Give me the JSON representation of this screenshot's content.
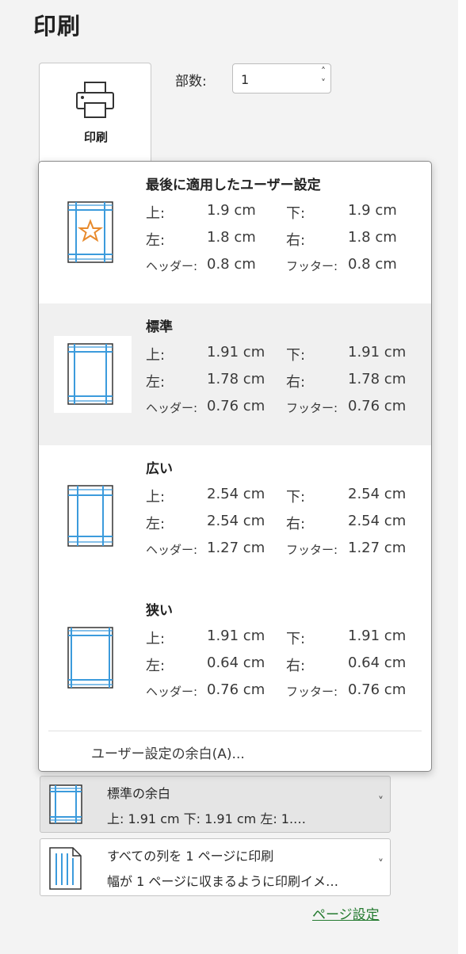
{
  "title": "印刷",
  "print_button": {
    "label": "印刷"
  },
  "copies": {
    "label": "部数:",
    "value": "1"
  },
  "margin_options": [
    {
      "name": "最後に適用したユーザー設定",
      "top_label": "上:",
      "top": "1.9 cm",
      "bottom_label": "下:",
      "bottom": "1.9 cm",
      "left_label": "左:",
      "left": "1.8 cm",
      "right_label": "右:",
      "right": "1.8 cm",
      "header_label": "ヘッダー:",
      "header": "0.8 cm",
      "footer_label": "フッター:",
      "footer": "0.8 cm",
      "icon": "custom-margins-star-icon"
    },
    {
      "name": "標準",
      "top_label": "上:",
      "top": "1.91 cm",
      "bottom_label": "下:",
      "bottom": "1.91 cm",
      "left_label": "左:",
      "left": "1.78 cm",
      "right_label": "右:",
      "right": "1.78 cm",
      "header_label": "ヘッダー:",
      "header": "0.76 cm",
      "footer_label": "フッター:",
      "footer": "0.76 cm",
      "icon": "normal-margins-icon"
    },
    {
      "name": "広い",
      "top_label": "上:",
      "top": "2.54 cm",
      "bottom_label": "下:",
      "bottom": "2.54 cm",
      "left_label": "左:",
      "left": "2.54 cm",
      "right_label": "右:",
      "right": "2.54 cm",
      "header_label": "ヘッダー:",
      "header": "1.27 cm",
      "footer_label": "フッター:",
      "footer": "1.27 cm",
      "icon": "wide-margins-icon"
    },
    {
      "name": "狭い",
      "top_label": "上:",
      "top": "1.91 cm",
      "bottom_label": "下:",
      "bottom": "1.91 cm",
      "left_label": "左:",
      "left": "0.64 cm",
      "right_label": "右:",
      "right": "0.64 cm",
      "header_label": "ヘッダー:",
      "header": "0.76 cm",
      "footer_label": "フッター:",
      "footer": "0.76 cm",
      "icon": "narrow-margins-icon"
    }
  ],
  "custom_margins_link": "ユーザー設定の余白(A)...",
  "margins_select": {
    "line1": "標準の余白",
    "line2": "上: 1.91 cm 下: 1.91 cm 左: 1.…"
  },
  "scaling_select": {
    "line1": "すべての列を 1 ページに印刷",
    "line2": "幅が 1 ページに収まるように印刷イメ…"
  },
  "page_setup_link": "ページ設定",
  "colors": {
    "accent_blue": "#3c9bdc",
    "star_orange": "#e88a2c",
    "link_green": "#237a2f"
  }
}
